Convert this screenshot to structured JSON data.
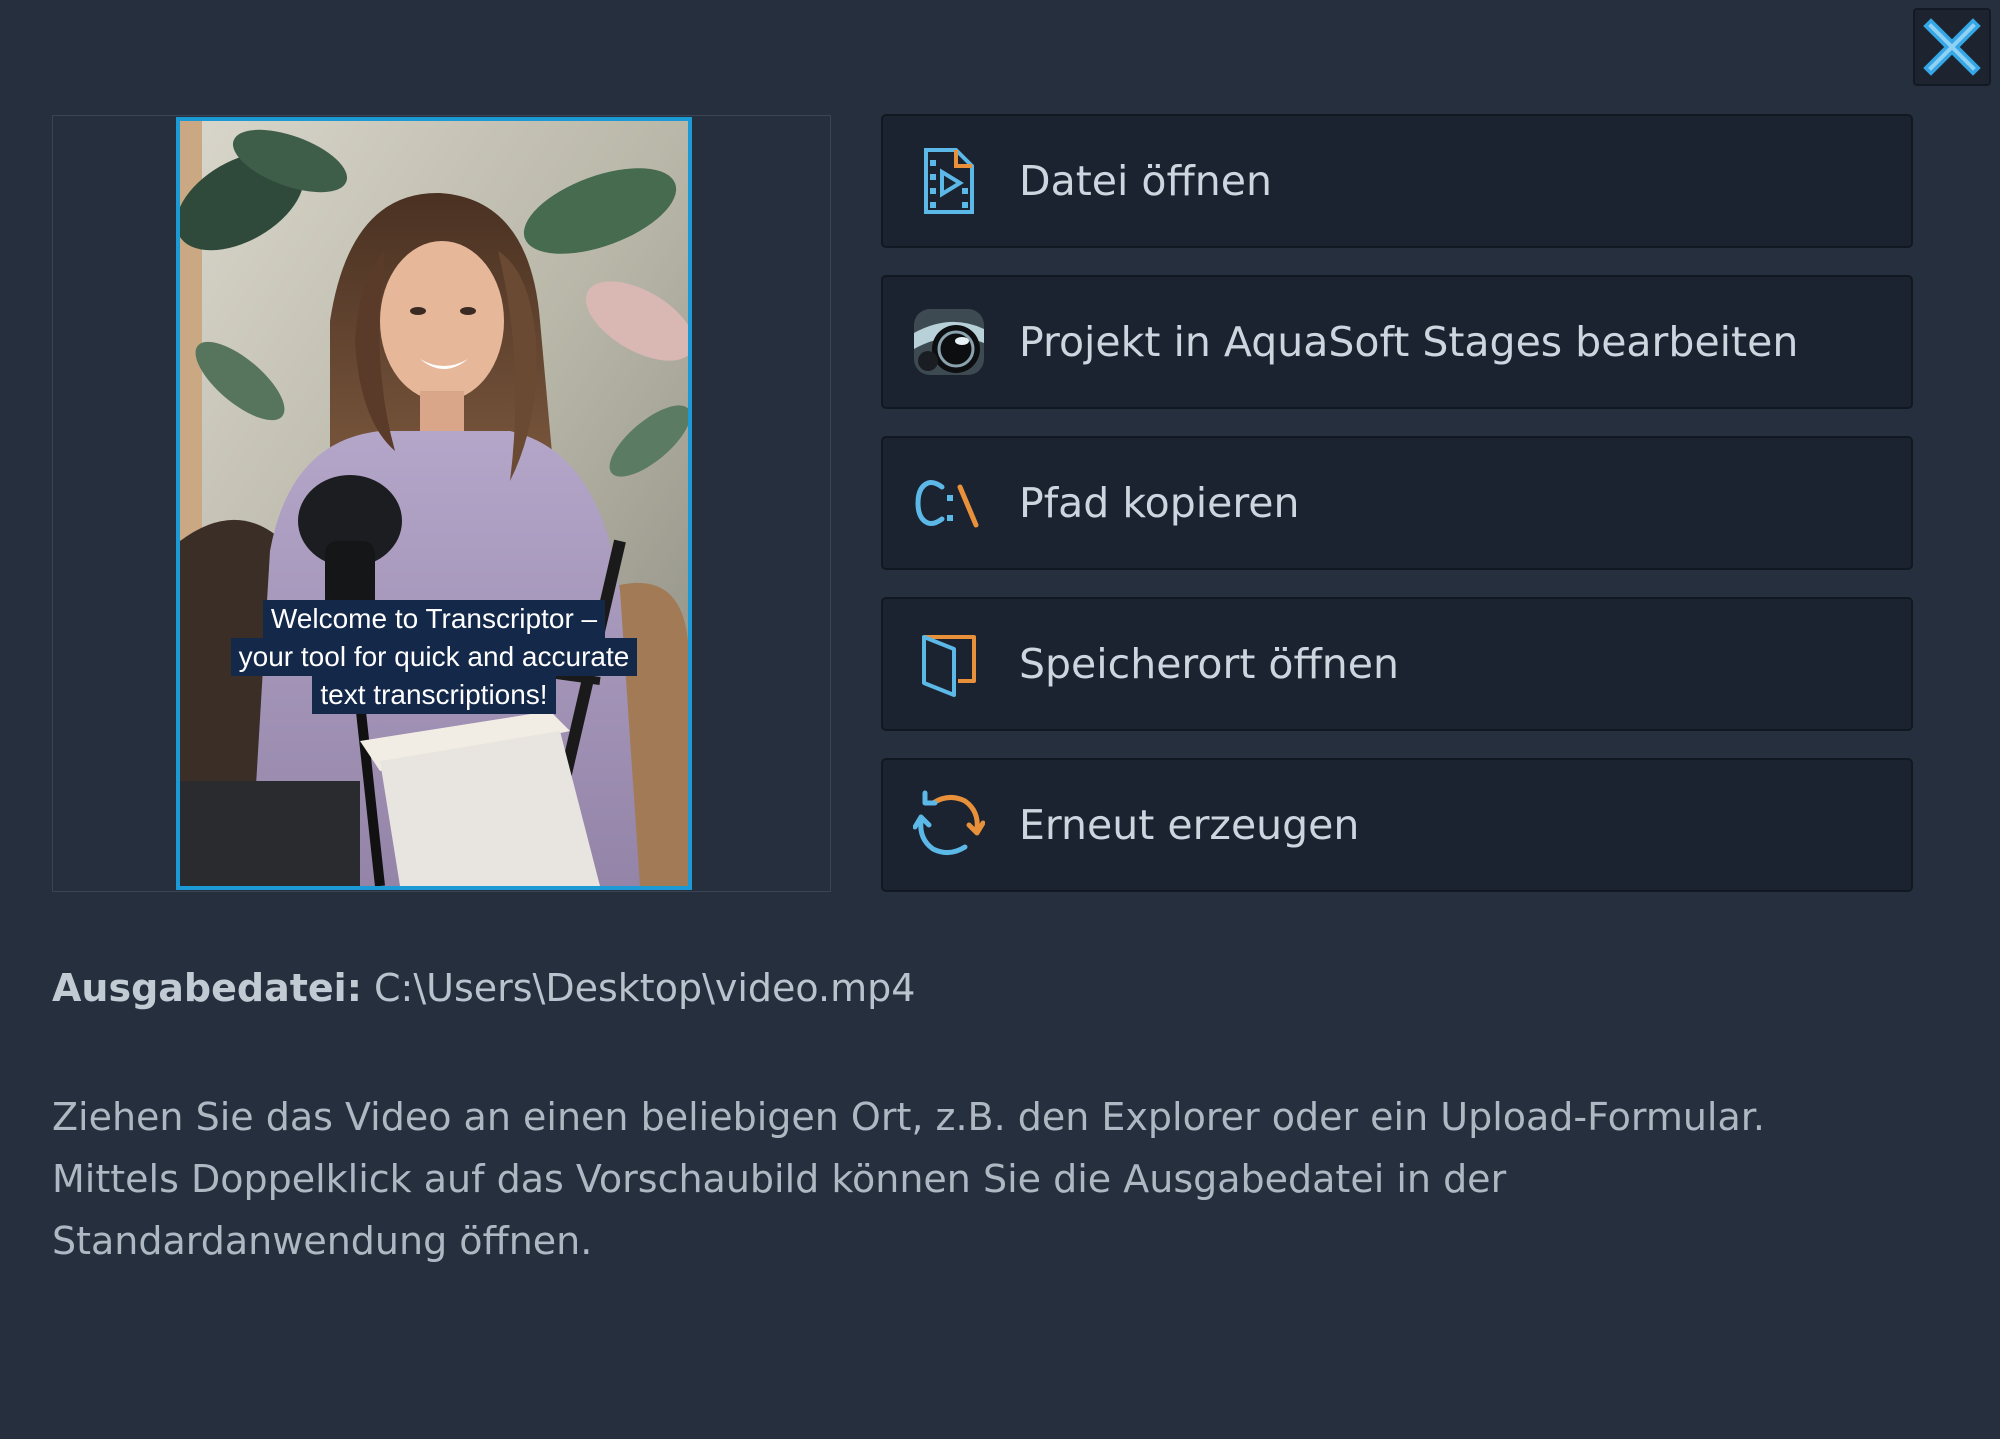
{
  "dialog": {
    "close_icon": "close-icon",
    "accent_color": "#1c9ad6",
    "background": "#262f3d"
  },
  "preview": {
    "caption_lines": [
      "Welcome to Transcriptor –",
      "your tool for quick and accurate",
      "text transcriptions!"
    ]
  },
  "actions": [
    {
      "label": "Datei öffnen",
      "icon": "video-file-icon"
    },
    {
      "label": "Projekt in AquaSoft Stages bearbeiten",
      "icon": "aquasoft-stages-icon"
    },
    {
      "label": "Pfad kopieren",
      "icon": "copy-path-icon"
    },
    {
      "label": "Speicherort öffnen",
      "icon": "folder-open-icon"
    },
    {
      "label": "Erneut erzeugen",
      "icon": "regenerate-icon"
    }
  ],
  "output": {
    "label": "Ausgabedatei:",
    "path": "C:\\Users\\Desktop\\video.mp4"
  },
  "help": {
    "lines": [
      "Ziehen Sie das Video an einen beliebigen Ort, z.B. den Explorer oder ein Upload-Formular.",
      "Mittels Doppelklick auf das Vorschaubild können Sie die Ausgabedatei in der",
      "Standardanwendung öffnen."
    ]
  }
}
